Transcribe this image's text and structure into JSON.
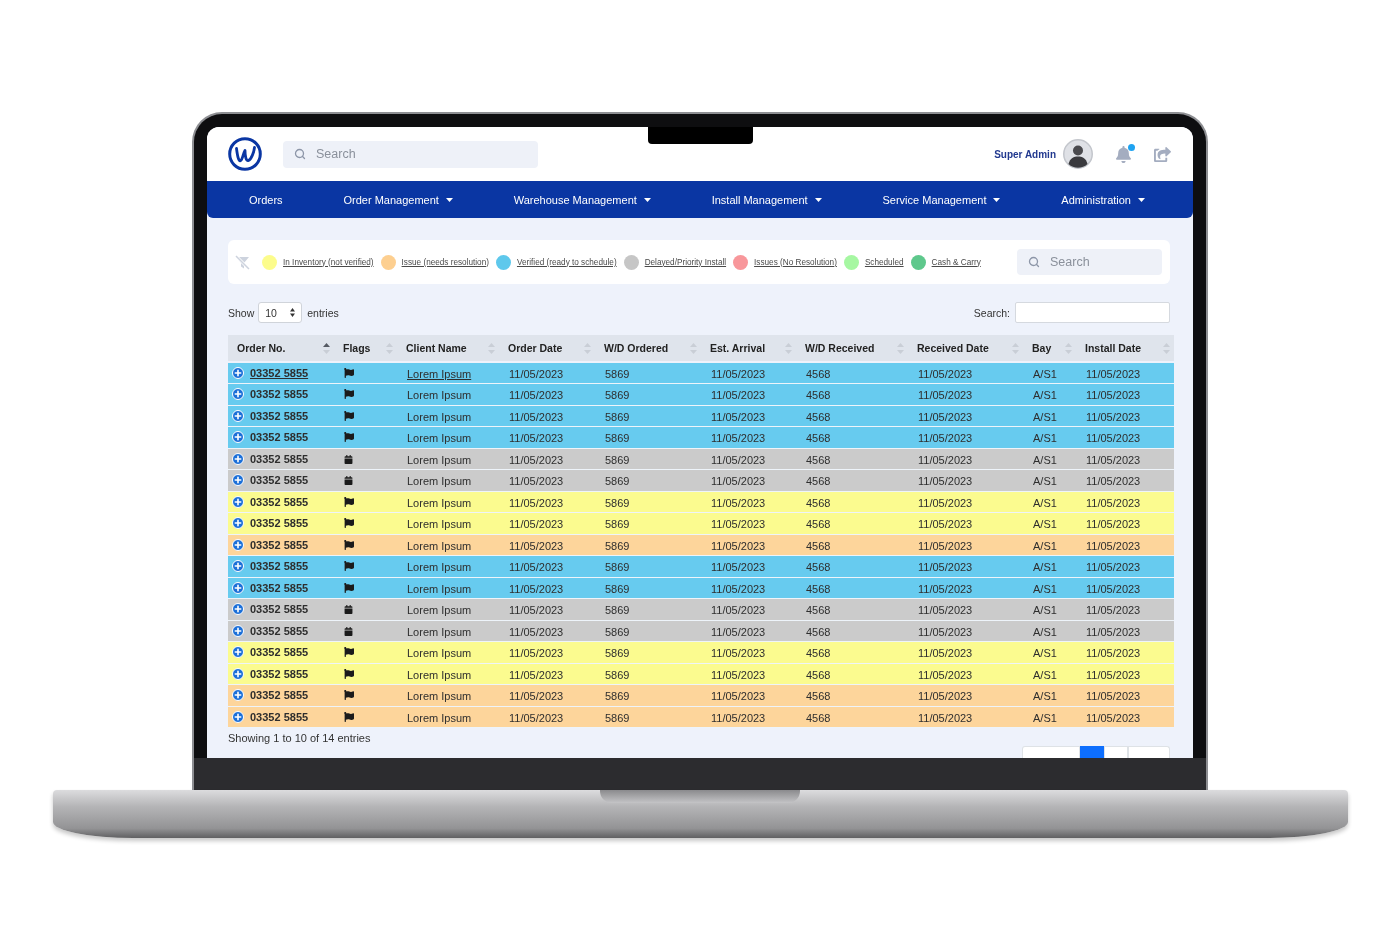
{
  "header": {
    "search": {
      "placeholder": "Search"
    },
    "user": {
      "name": "Super Admin"
    },
    "notifications": {
      "unread": true
    }
  },
  "nav": [
    {
      "label": "Orders",
      "dropdown": false
    },
    {
      "label": "Order Management",
      "dropdown": true
    },
    {
      "label": "Warehouse Management",
      "dropdown": true
    },
    {
      "label": "Install Management",
      "dropdown": true
    },
    {
      "label": "Service Management",
      "dropdown": true
    },
    {
      "label": "Administration",
      "dropdown": true
    }
  ],
  "legend": {
    "items": [
      {
        "label": "In Inventory (not verified)",
        "color": "#fcfc8c"
      },
      {
        "label": "Issue (needs resolution)",
        "color": "#fdcf90"
      },
      {
        "label": "Verified (ready to schedule)",
        "color": "#5ec8ec"
      },
      {
        "label": "Delayed/Priority Install",
        "color": "#c6c6c6"
      },
      {
        "label": "Issues (No Resolution)",
        "color": "#f8979b"
      },
      {
        "label": "Scheduled",
        "color": "#a6f7a2"
      },
      {
        "label": "Cash & Carry",
        "color": "#5ec88c"
      }
    ],
    "search": {
      "placeholder": "Search"
    }
  },
  "table_controls": {
    "show_label": "Show",
    "page_size": "10",
    "entries_label": "entries",
    "search_label": "Search:"
  },
  "table": {
    "columns": [
      {
        "label": "Order No.",
        "sorted": true
      },
      {
        "label": "Flags",
        "sorted": false
      },
      {
        "label": "Client Name",
        "sorted": false
      },
      {
        "label": "Order Date",
        "sorted": false
      },
      {
        "label": "W/D Ordered",
        "sorted": false
      },
      {
        "label": "Est. Arrival",
        "sorted": false
      },
      {
        "label": "W/D Received",
        "sorted": false
      },
      {
        "label": "Received Date",
        "sorted": false
      },
      {
        "label": "Bay",
        "sorted": false
      },
      {
        "label": "Install Date",
        "sorted": false
      }
    ],
    "rows": [
      {
        "kind": "flag",
        "color": "#67cbef",
        "hovered": true,
        "order_no": "03352 5855",
        "client": "Lorem Ipsum",
        "order_date": "11/05/2023",
        "wd_ordered": "5869",
        "est_arrival": "11/05/2023",
        "wd_received": "4568",
        "received_date": "11/05/2023",
        "bay": "A/S1",
        "install_date": "11/05/2023"
      },
      {
        "kind": "flag",
        "color": "#67cbef",
        "hovered": false,
        "order_no": "03352 5855",
        "client": "Lorem Ipsum",
        "order_date": "11/05/2023",
        "wd_ordered": "5869",
        "est_arrival": "11/05/2023",
        "wd_received": "4568",
        "received_date": "11/05/2023",
        "bay": "A/S1",
        "install_date": "11/05/2023"
      },
      {
        "kind": "flag",
        "color": "#67cbef",
        "hovered": false,
        "order_no": "03352 5855",
        "client": "Lorem Ipsum",
        "order_date": "11/05/2023",
        "wd_ordered": "5869",
        "est_arrival": "11/05/2023",
        "wd_received": "4568",
        "received_date": "11/05/2023",
        "bay": "A/S1",
        "install_date": "11/05/2023"
      },
      {
        "kind": "flag",
        "color": "#67cbef",
        "hovered": false,
        "order_no": "03352 5855",
        "client": "Lorem Ipsum",
        "order_date": "11/05/2023",
        "wd_ordered": "5869",
        "est_arrival": "11/05/2023",
        "wd_received": "4568",
        "received_date": "11/05/2023",
        "bay": "A/S1",
        "install_date": "11/05/2023"
      },
      {
        "kind": "calendar",
        "color": "#cbcbcb",
        "hovered": false,
        "order_no": "03352 5855",
        "client": "Lorem Ipsum",
        "order_date": "11/05/2023",
        "wd_ordered": "5869",
        "est_arrival": "11/05/2023",
        "wd_received": "4568",
        "received_date": "11/05/2023",
        "bay": "A/S1",
        "install_date": "11/05/2023"
      },
      {
        "kind": "calendar",
        "color": "#cbcbcb",
        "hovered": false,
        "order_no": "03352 5855",
        "client": "Lorem Ipsum",
        "order_date": "11/05/2023",
        "wd_ordered": "5869",
        "est_arrival": "11/05/2023",
        "wd_received": "4568",
        "received_date": "11/05/2023",
        "bay": "A/S1",
        "install_date": "11/05/2023"
      },
      {
        "kind": "flag",
        "color": "#fbfb8f",
        "hovered": false,
        "order_no": "03352 5855",
        "client": "Lorem Ipsum",
        "order_date": "11/05/2023",
        "wd_ordered": "5869",
        "est_arrival": "11/05/2023",
        "wd_received": "4568",
        "received_date": "11/05/2023",
        "bay": "A/S1",
        "install_date": "11/05/2023"
      },
      {
        "kind": "flag",
        "color": "#fbfb8f",
        "hovered": false,
        "order_no": "03352 5855",
        "client": "Lorem Ipsum",
        "order_date": "11/05/2023",
        "wd_ordered": "5869",
        "est_arrival": "11/05/2023",
        "wd_received": "4568",
        "received_date": "11/05/2023",
        "bay": "A/S1",
        "install_date": "11/05/2023"
      },
      {
        "kind": "flag",
        "color": "#fdd59b",
        "hovered": false,
        "order_no": "03352 5855",
        "client": "Lorem Ipsum",
        "order_date": "11/05/2023",
        "wd_ordered": "5869",
        "est_arrival": "11/05/2023",
        "wd_received": "4568",
        "received_date": "11/05/2023",
        "bay": "A/S1",
        "install_date": "11/05/2023"
      },
      {
        "kind": "flag",
        "color": "#67cbef",
        "hovered": false,
        "order_no": "03352 5855",
        "client": "Lorem Ipsum",
        "order_date": "11/05/2023",
        "wd_ordered": "5869",
        "est_arrival": "11/05/2023",
        "wd_received": "4568",
        "received_date": "11/05/2023",
        "bay": "A/S1",
        "install_date": "11/05/2023"
      },
      {
        "kind": "flag",
        "color": "#67cbef",
        "hovered": false,
        "order_no": "03352 5855",
        "client": "Lorem Ipsum",
        "order_date": "11/05/2023",
        "wd_ordered": "5869",
        "est_arrival": "11/05/2023",
        "wd_received": "4568",
        "received_date": "11/05/2023",
        "bay": "A/S1",
        "install_date": "11/05/2023"
      },
      {
        "kind": "calendar",
        "color": "#cbcbcb",
        "hovered": false,
        "order_no": "03352 5855",
        "client": "Lorem Ipsum",
        "order_date": "11/05/2023",
        "wd_ordered": "5869",
        "est_arrival": "11/05/2023",
        "wd_received": "4568",
        "received_date": "11/05/2023",
        "bay": "A/S1",
        "install_date": "11/05/2023"
      },
      {
        "kind": "calendar",
        "color": "#cbcbcb",
        "hovered": false,
        "order_no": "03352 5855",
        "client": "Lorem Ipsum",
        "order_date": "11/05/2023",
        "wd_ordered": "5869",
        "est_arrival": "11/05/2023",
        "wd_received": "4568",
        "received_date": "11/05/2023",
        "bay": "A/S1",
        "install_date": "11/05/2023"
      },
      {
        "kind": "flag",
        "color": "#fbfb8f",
        "hovered": false,
        "order_no": "03352 5855",
        "client": "Lorem Ipsum",
        "order_date": "11/05/2023",
        "wd_ordered": "5869",
        "est_arrival": "11/05/2023",
        "wd_received": "4568",
        "received_date": "11/05/2023",
        "bay": "A/S1",
        "install_date": "11/05/2023"
      },
      {
        "kind": "flag",
        "color": "#fbfb8f",
        "hovered": false,
        "order_no": "03352 5855",
        "client": "Lorem Ipsum",
        "order_date": "11/05/2023",
        "wd_ordered": "5869",
        "est_arrival": "11/05/2023",
        "wd_received": "4568",
        "received_date": "11/05/2023",
        "bay": "A/S1",
        "install_date": "11/05/2023"
      },
      {
        "kind": "flag",
        "color": "#fdd59b",
        "hovered": false,
        "order_no": "03352 5855",
        "client": "Lorem Ipsum",
        "order_date": "11/05/2023",
        "wd_ordered": "5869",
        "est_arrival": "11/05/2023",
        "wd_received": "4568",
        "received_date": "11/05/2023",
        "bay": "A/S1",
        "install_date": "11/05/2023"
      },
      {
        "kind": "flag",
        "color": "#fdd59b",
        "hovered": false,
        "order_no": "03352 5855",
        "client": "Lorem Ipsum",
        "order_date": "11/05/2023",
        "wd_ordered": "5869",
        "est_arrival": "11/05/2023",
        "wd_received": "4568",
        "received_date": "11/05/2023",
        "bay": "A/S1",
        "install_date": "11/05/2023"
      }
    ]
  },
  "footer": {
    "info": "Showing 1 to 10 of 14 entries",
    "pagination": [
      {
        "selected": false
      },
      {
        "selected": true
      },
      {
        "selected": false
      },
      {
        "selected": false
      }
    ]
  }
}
